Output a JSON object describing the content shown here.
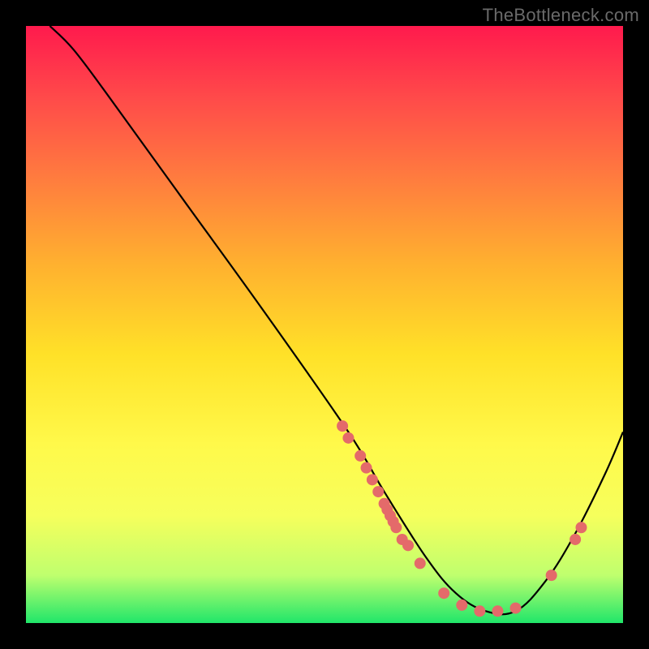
{
  "watermark": "TheBottleneck.com",
  "chart_data": {
    "type": "line",
    "title": "",
    "xlabel": "",
    "ylabel": "",
    "xlim": [
      0,
      100
    ],
    "ylim": [
      0,
      100
    ],
    "grid": false,
    "curve": [
      {
        "x": 4,
        "y": 100
      },
      {
        "x": 8,
        "y": 96
      },
      {
        "x": 14,
        "y": 88
      },
      {
        "x": 27,
        "y": 70
      },
      {
        "x": 40,
        "y": 52
      },
      {
        "x": 54,
        "y": 32
      },
      {
        "x": 60,
        "y": 22
      },
      {
        "x": 67,
        "y": 11
      },
      {
        "x": 72,
        "y": 5
      },
      {
        "x": 77,
        "y": 2
      },
      {
        "x": 82,
        "y": 2
      },
      {
        "x": 87,
        "y": 7
      },
      {
        "x": 92,
        "y": 15
      },
      {
        "x": 97,
        "y": 25
      },
      {
        "x": 100,
        "y": 32
      }
    ],
    "points": [
      {
        "x": 53,
        "y": 33
      },
      {
        "x": 54,
        "y": 31
      },
      {
        "x": 56,
        "y": 28
      },
      {
        "x": 57,
        "y": 26
      },
      {
        "x": 58,
        "y": 24
      },
      {
        "x": 59,
        "y": 22
      },
      {
        "x": 60,
        "y": 20
      },
      {
        "x": 60.5,
        "y": 19
      },
      {
        "x": 61,
        "y": 18
      },
      {
        "x": 61.5,
        "y": 17
      },
      {
        "x": 62,
        "y": 16
      },
      {
        "x": 63,
        "y": 14
      },
      {
        "x": 64,
        "y": 13
      },
      {
        "x": 66,
        "y": 10
      },
      {
        "x": 70,
        "y": 5
      },
      {
        "x": 73,
        "y": 3
      },
      {
        "x": 76,
        "y": 2
      },
      {
        "x": 79,
        "y": 2
      },
      {
        "x": 82,
        "y": 2.5
      },
      {
        "x": 88,
        "y": 8
      },
      {
        "x": 92,
        "y": 14
      },
      {
        "x": 93,
        "y": 16
      }
    ],
    "colors": {
      "curve": "#000000",
      "points": "#e46a6a",
      "gradient_top": "#ff1a4d",
      "gradient_bottom": "#20e66a"
    }
  }
}
